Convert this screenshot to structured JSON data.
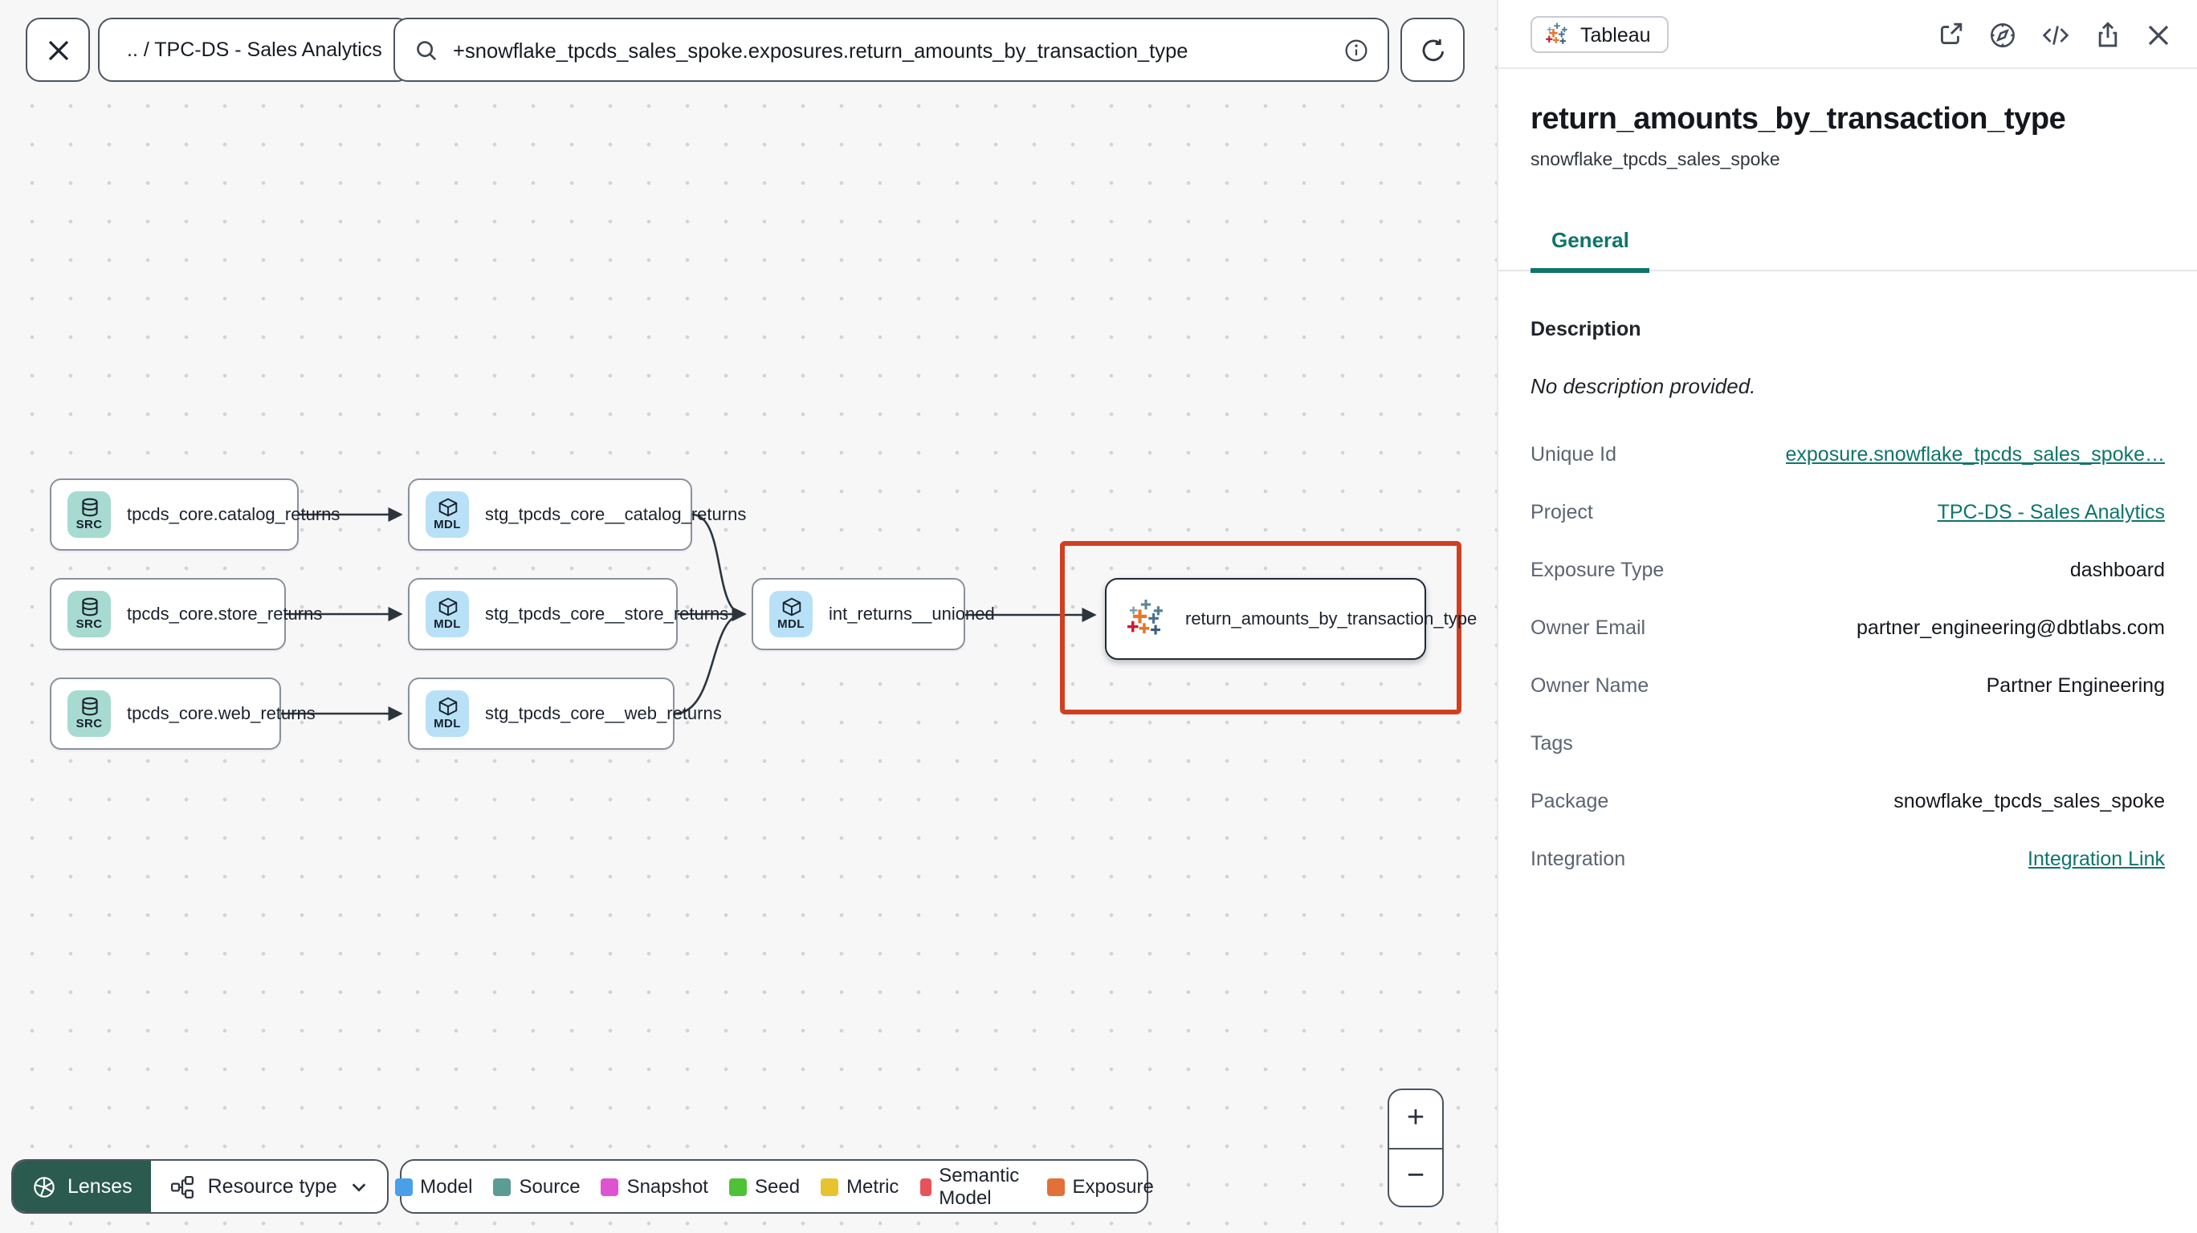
{
  "toolbar": {
    "breadcrumb": ".. / TPC-DS - Sales Analytics",
    "search": {
      "value": "+snowflake_tpcds_sales_spoke.exposures.return_amounts_by_transaction_type"
    }
  },
  "graph": {
    "nodes": [
      {
        "label": "tpcds_core.catalog_returns",
        "badge": "SRC",
        "type": "source"
      },
      {
        "label": "tpcds_core.store_returns",
        "badge": "SRC",
        "type": "source"
      },
      {
        "label": "tpcds_core.web_returns",
        "badge": "SRC",
        "type": "source"
      },
      {
        "label": "stg_tpcds_core__catalog_returns",
        "badge": "MDL",
        "type": "model"
      },
      {
        "label": "stg_tpcds_core__store_returns",
        "badge": "MDL",
        "type": "model"
      },
      {
        "label": "stg_tpcds_core__web_returns",
        "badge": "MDL",
        "type": "model"
      },
      {
        "label": "int_returns__unioned",
        "badge": "MDL",
        "type": "model"
      },
      {
        "label": "return_amounts_by_transaction_type",
        "type": "exposure-tableau",
        "selected": true
      }
    ],
    "highlight_color": "#d04020"
  },
  "legend": {
    "lenses_label": "Lenses",
    "resource_type_label": "Resource type",
    "items": [
      {
        "label": "Model",
        "color": "#49a0e8"
      },
      {
        "label": "Source",
        "color": "#5b9c96"
      },
      {
        "label": "Snapshot",
        "color": "#df53d3"
      },
      {
        "label": "Seed",
        "color": "#4fc136"
      },
      {
        "label": "Metric",
        "color": "#e7c42f"
      },
      {
        "label": "Semantic Model",
        "color": "#e8525a"
      },
      {
        "label": "Exposure",
        "color": "#e2703a"
      }
    ]
  },
  "zoom_controls": {
    "zoom_in": "+",
    "zoom_out": "−"
  },
  "panel": {
    "integration_badge": "Tableau",
    "title": "return_amounts_by_transaction_type",
    "subtitle": "snowflake_tpcds_sales_spoke",
    "tabs": [
      {
        "label": "General",
        "active": true
      }
    ],
    "icons": [
      "external-link-icon",
      "compass-icon",
      "code-icon",
      "share-icon",
      "close-icon"
    ],
    "description_heading": "Description",
    "description_empty": "No description provided.",
    "fields": [
      {
        "label": "Unique Id",
        "value": "exposure.snowflake_tpcds_sales_spoke…",
        "link": true
      },
      {
        "label": "Project",
        "value": "TPC-DS - Sales Analytics",
        "link": true
      },
      {
        "label": "Exposure Type",
        "value": "dashboard"
      },
      {
        "label": "Owner Email",
        "value": "partner_engineering@dbtlabs.com"
      },
      {
        "label": "Owner Name",
        "value": "Partner Engineering"
      },
      {
        "label": "Tags",
        "value": ""
      },
      {
        "label": "Package",
        "value": "snowflake_tpcds_sales_spoke"
      },
      {
        "label": "Integration",
        "value": "Integration Link",
        "link": true
      }
    ],
    "accent_color": "#0e756b"
  }
}
